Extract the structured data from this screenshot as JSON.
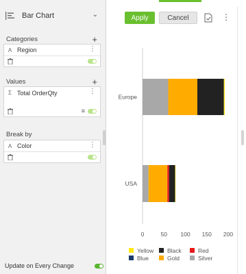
{
  "chart_type": {
    "label": "Bar Chart"
  },
  "categories_section": {
    "title": "Categories",
    "field": "Region",
    "field_type": "A"
  },
  "values_section": {
    "title": "Values",
    "field": "Total OrderQty",
    "field_type": "Σ"
  },
  "breakby_section": {
    "title": "Break by",
    "field": "Color",
    "field_type": "A"
  },
  "update": {
    "label": "Update on Every Change"
  },
  "toolbar": {
    "apply": "Apply",
    "cancel": "Cancel"
  },
  "colors": {
    "accent": "#6abf2f"
  },
  "chart_data": {
    "type": "bar",
    "orientation": "horizontal",
    "stacked": true,
    "categories": [
      "Europe",
      "USA"
    ],
    "series": [
      {
        "name": "Silver",
        "color": "#a8a8a8",
        "values": [
          60,
          14
        ]
      },
      {
        "name": "Gold",
        "color": "#ffab00",
        "values": [
          68,
          44
        ]
      },
      {
        "name": "Red",
        "color": "#e81818",
        "values": [
          0,
          4
        ]
      },
      {
        "name": "Black",
        "color": "#222222",
        "values": [
          62,
          14
        ]
      },
      {
        "name": "Blue",
        "color": "#1b3a6b",
        "values": [
          0,
          0
        ]
      },
      {
        "name": "Yellow",
        "color": "#ffe812",
        "values": [
          2,
          1
        ]
      }
    ],
    "xticks": [
      "0",
      "50",
      "100",
      "150",
      "200"
    ],
    "xlim": [
      0,
      215
    ],
    "legend": [
      {
        "name": "Yellow",
        "color": "#ffe812"
      },
      {
        "name": "Black",
        "color": "#222222"
      },
      {
        "name": "Red",
        "color": "#e81818"
      },
      {
        "name": "Blue",
        "color": "#1b3a6b"
      },
      {
        "name": "Gold",
        "color": "#ffab00"
      },
      {
        "name": "Silver",
        "color": "#a8a8a8"
      }
    ],
    "legend_position": "bottom",
    "grid": false
  }
}
